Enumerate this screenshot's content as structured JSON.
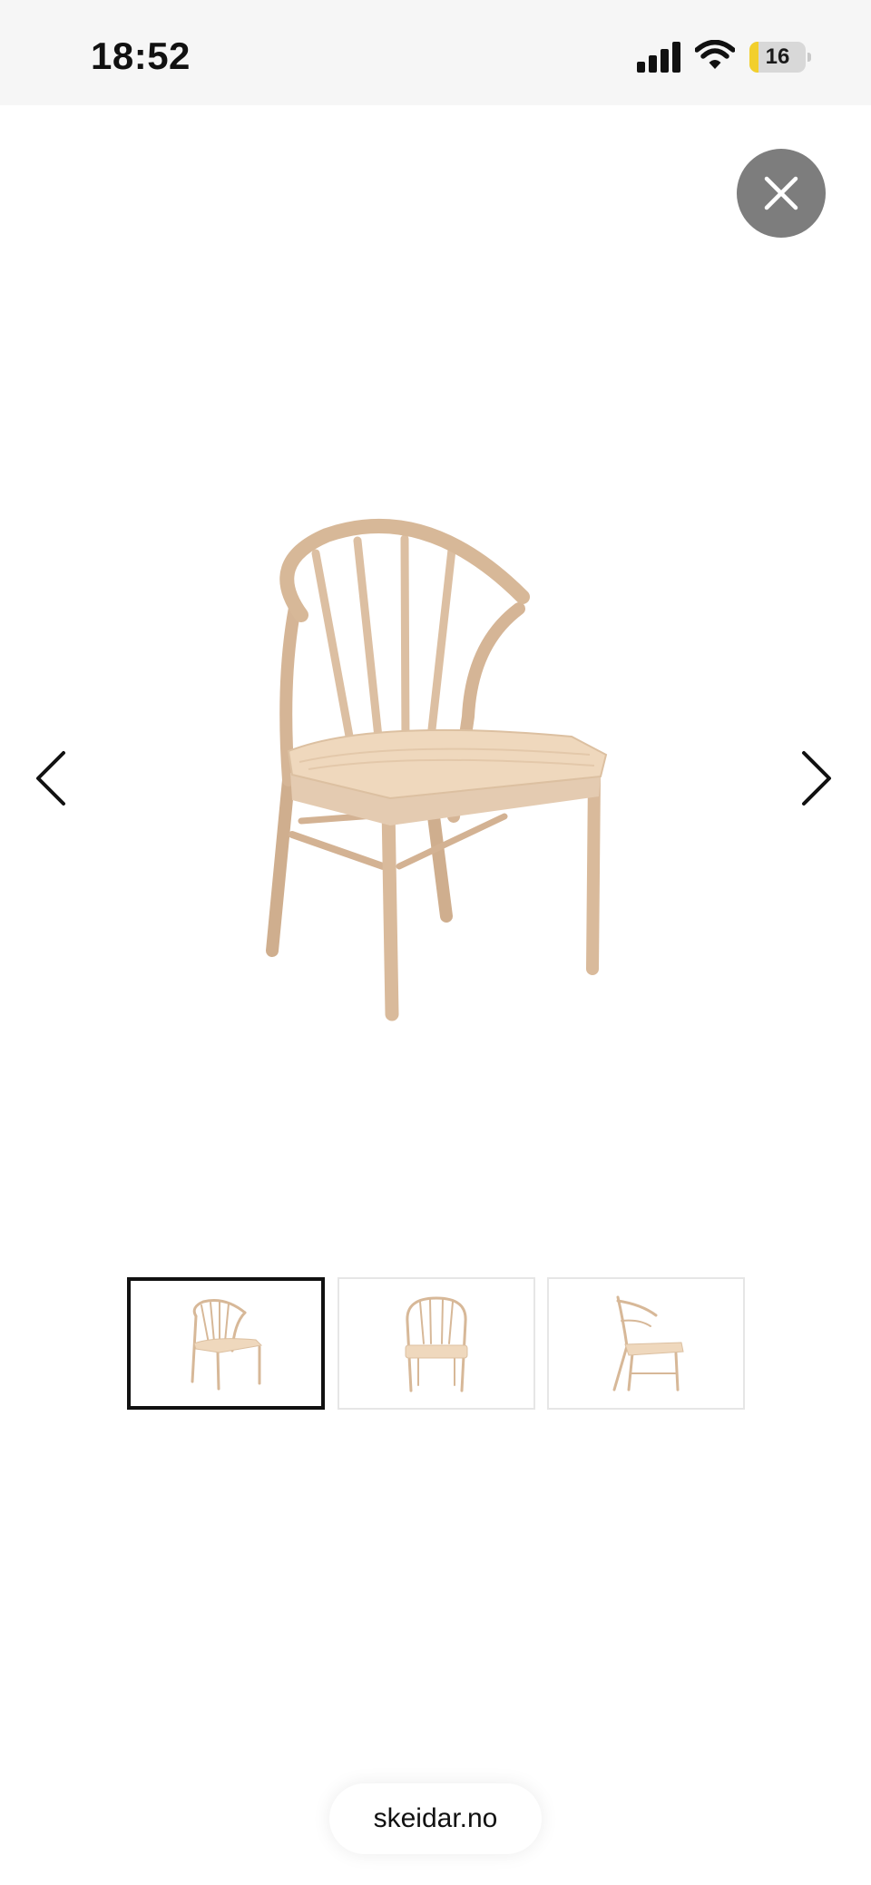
{
  "status_bar": {
    "time": "18:52",
    "battery_level": "16",
    "battery_fraction": 0.16,
    "signal_icon": "cellular-signal-icon",
    "wifi_icon": "wifi-icon"
  },
  "gallery": {
    "close_icon": "close-icon",
    "prev_icon": "chevron-left-icon",
    "next_icon": "chevron-right-icon",
    "main_image_icon": "wooden-chair-image",
    "thumbnails": [
      {
        "view": "angled-view",
        "selected": true
      },
      {
        "view": "front-view",
        "selected": false
      },
      {
        "view": "side-view",
        "selected": false
      }
    ]
  },
  "browser": {
    "url": "skeidar.no"
  },
  "colors": {
    "wood": "#d7b898",
    "wood_shadow": "#c09e7f",
    "seat": "#efd8bd",
    "status_bg": "#f6f6f6",
    "close_bg": "#7d7d7d",
    "battery_fill": "#f2cf2c"
  }
}
